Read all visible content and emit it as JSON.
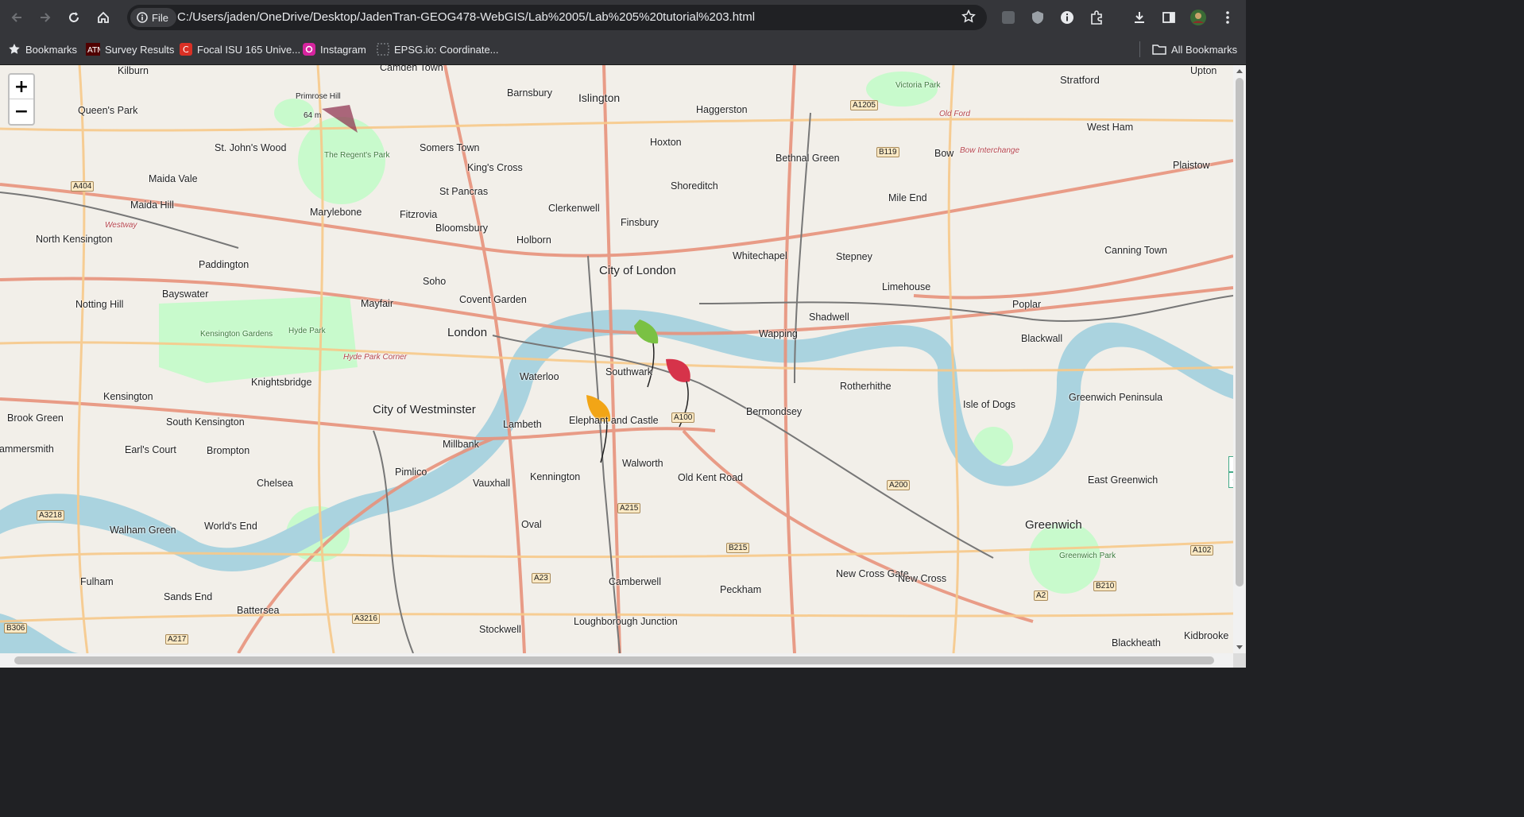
{
  "browser": {
    "file_chip": "File",
    "url": "C:/Users/jaden/OneDrive/Desktop/JadenTran-GEOG478-WebGIS/Lab%2005/Lab%205%20tutorial%203.html"
  },
  "bookmarks": {
    "items": [
      "Bookmarks",
      "Survey Results",
      "Focal ISU 165 Unive...",
      "Instagram",
      "EPSG.io: Coordinate..."
    ],
    "all": "All Bookmarks"
  },
  "map": {
    "zoom_in": "+",
    "zoom_out": "−",
    "places": [
      "Camden Town",
      "Kilburn",
      "Queen's Park",
      "Primrose Hill",
      "64 m",
      "Barnsbury",
      "Islington",
      "Haggerston",
      "Victoria Park",
      "Stratford",
      "Upton",
      "Somers Town",
      "St. John's Wood",
      "The Regent's Park",
      "King's Cross",
      "Hoxton",
      "Bethnal Green",
      "Old Ford",
      "West Ham",
      "Maida Vale",
      "St Pancras",
      "Bow",
      "Bow Interchange",
      "Plaistow",
      "Maida Hill",
      "Marylebone",
      "Fitzrovia",
      "Clerkenwell",
      "Shoreditch",
      "Mile End",
      "North Kensington",
      "Westway",
      "Bloomsbury",
      "Holborn",
      "Finsbury",
      "Paddington",
      "Whitechapel",
      "Stepney",
      "Canning Town",
      "City of London",
      "Soho",
      "Limehouse",
      "Notting Hill",
      "Bayswater",
      "Mayfair",
      "Covent Garden",
      "Poplar",
      "Shadwell",
      "London",
      "Wapping",
      "Blackwall",
      "Kensington Gardens",
      "Hyde Park",
      "Hyde Park Corner",
      "Waterloo",
      "Southwark",
      "Rotherhithe",
      "Knightsbridge",
      "Greenwich Peninsula",
      "Kensington",
      "City of Westminster",
      "Elephant and Castle",
      "Bermondsey",
      "Isle of Dogs",
      "Brook Green",
      "South Kensington",
      "Lambeth",
      "Millbank",
      "Hammersmith",
      "Earl's Court",
      "Brompton",
      "Walworth",
      "Pimlico",
      "Vauxhall",
      "Kennington",
      "Old Kent Road",
      "East Greenwich",
      "Chelsea",
      "Greenwich",
      "World's End",
      "Walham Green",
      "Oval",
      "Peckham",
      "New Cross Gate",
      "New Cross",
      "Greenwich Park",
      "Fulham",
      "Sands End",
      "Camberwell",
      "Battersea",
      "Stockwell",
      "Loughborough Junction",
      "Blackheath",
      "Kidbrooke"
    ],
    "roads": [
      "A1205",
      "B119",
      "A404",
      "A100",
      "A200",
      "A215",
      "B215",
      "A3218",
      "A23",
      "A3216",
      "A217",
      "B306",
      "A102",
      "A2",
      "B210"
    ]
  },
  "colors": {
    "leaf_green": "#7ac143",
    "leaf_red": "#d6334a",
    "leaf_orange": "#f2a516",
    "thames": "#aad3df",
    "park": "#c8facc"
  }
}
